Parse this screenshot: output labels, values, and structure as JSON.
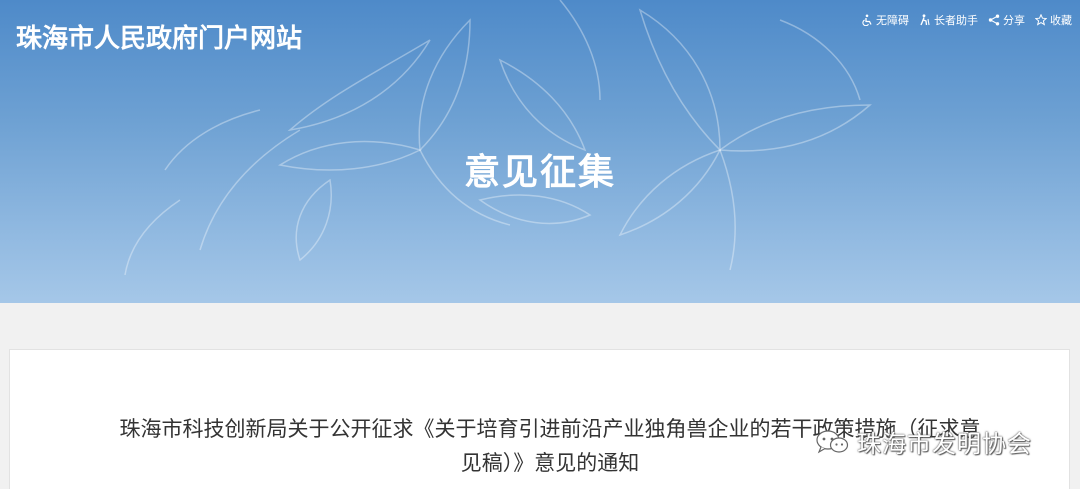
{
  "header": {
    "site_title": "珠海市人民政府门户网站",
    "toolbar": [
      {
        "icon": "accessibility-icon",
        "label": "无障碍"
      },
      {
        "icon": "elderly-assist-icon",
        "label": "长者助手"
      },
      {
        "icon": "share-icon",
        "label": "分享"
      },
      {
        "icon": "star-icon",
        "label": "收藏"
      }
    ]
  },
  "banner": {
    "section_title": "意见征集"
  },
  "content": {
    "notice_title": "珠海市科技创新局关于公开征求《关于培育引进前沿产业独角兽企业的若干政策措施（征求意见稿）》意见的通知"
  },
  "watermark": {
    "text": "珠海市发明协会"
  },
  "colors": {
    "banner_top": "#4e8ac9",
    "banner_bottom": "#a5c7e8",
    "page_background": "#f1f1f1",
    "title_text": "#333333"
  }
}
